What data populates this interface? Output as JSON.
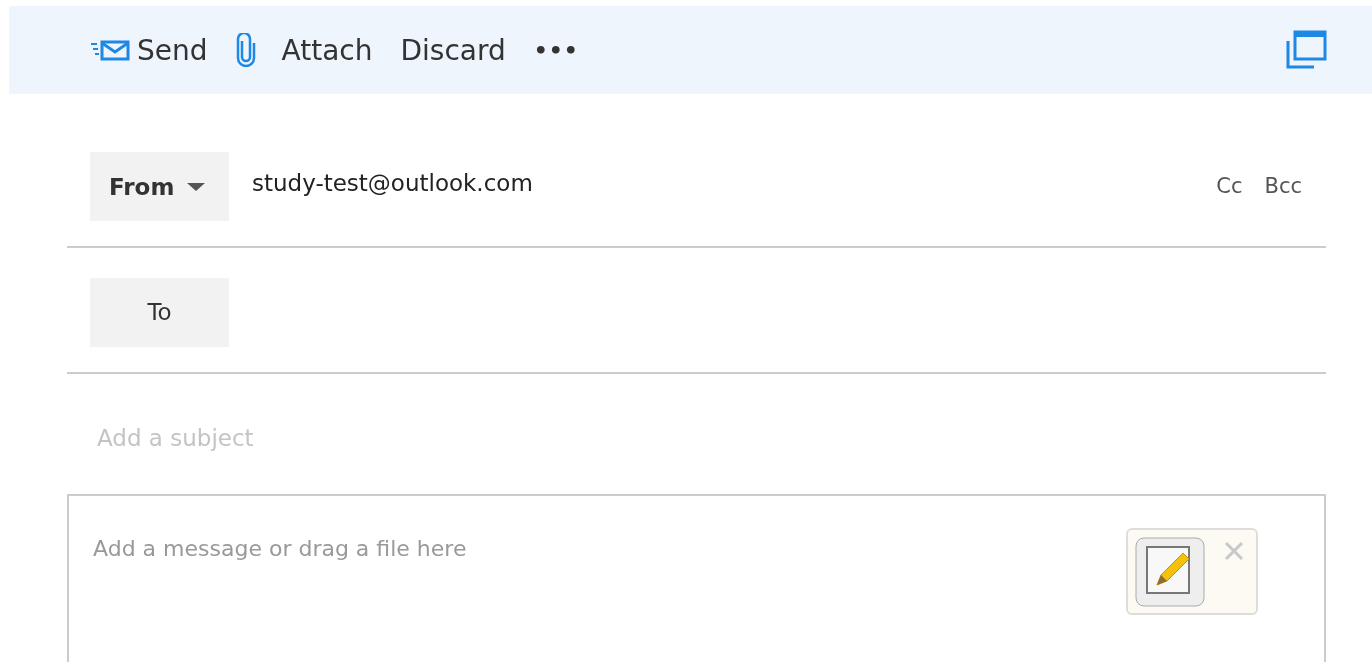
{
  "toolbar": {
    "actions": [
      {
        "kind": "send",
        "label": "Send"
      },
      {
        "kind": "attach",
        "label": "Attach"
      },
      {
        "kind": "text",
        "label": "Discard"
      },
      {
        "kind": "text",
        "label": "•••"
      }
    ]
  },
  "from": {
    "label": "From",
    "value": "study-test@outlook.com",
    "links": [
      "Cc",
      "Bcc"
    ]
  },
  "to": {
    "label": "To"
  },
  "subject": {
    "placeholder": "Add a subject"
  },
  "body": {
    "placeholder": "Add a message or drag a file here"
  }
}
